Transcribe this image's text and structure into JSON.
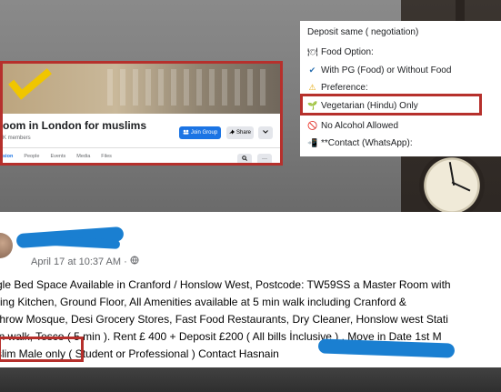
{
  "group_card": {
    "title": "oom in London for muslims",
    "members": "K members",
    "join_label": "Join Group",
    "join_icon": "group-icon",
    "share_label": "Share",
    "share_icon": "share-icon",
    "tabs": [
      "sion",
      "People",
      "Events",
      "Media",
      "Files"
    ],
    "accent_color": "#1b74e4",
    "highlight_color": "#b6302c"
  },
  "info_panel": {
    "lines": [
      {
        "icon": "",
        "text": "Deposit same ( negotiation)"
      },
      {
        "icon": "plate-icon",
        "text": "Food Option:"
      },
      {
        "icon": "check-icon",
        "text": "With PG (Food) or Without Food"
      },
      {
        "icon": "warning-icon",
        "text": "Preference:"
      },
      {
        "icon": "seedling-icon",
        "text": "Vegetarian (Hindu) Only"
      },
      {
        "icon": "no-icon",
        "text": "No Alcohol Allowed"
      },
      {
        "icon": "phone-icon",
        "text": "**Contact (WhatsApp):"
      }
    ]
  },
  "post": {
    "time": "April 17 at 10:37 AM · ",
    "globe_icon": "globe-icon",
    "lines": [
      "gle Bed Space Available in Cranford / Honslow West, Postcode: TW59SS a Master Room with",
      "ring Kitchen, Ground Floor, All Amenities available at 5 min walk including Cranford &",
      "throw Mosque, Desi Grocery Stores, Fast Food Restaurants, Dry Cleaner, Honslow west Stati",
      "in walk,  Tesco ( 5 min ). Rent £ 400 + Deposit £200 ( All bills İnclusive ) . Move in Date 1st M",
      "slim Male only ( Student or Professional ) Contact Hasnain "
    ]
  }
}
